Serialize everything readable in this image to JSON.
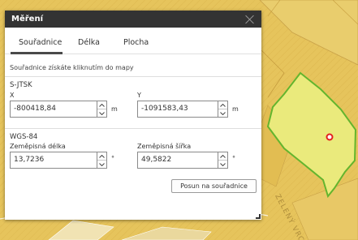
{
  "dialog": {
    "title": "Měření",
    "tabs": [
      {
        "label": "Souřadnice",
        "active": true
      },
      {
        "label": "Délka",
        "active": false
      },
      {
        "label": "Plocha",
        "active": false
      }
    ],
    "hint": "Souřadnice získáte kliknutím do mapy",
    "sjtsk": {
      "section_label": "S-JTSK",
      "x_label": "X",
      "x_value": "-800418,84",
      "x_unit": "m",
      "y_label": "Y",
      "y_value": "-1091583,43",
      "y_unit": "m"
    },
    "wgs84": {
      "section_label": "WGS-84",
      "lon_label": "Zeměpisná délka",
      "lon_value": "13,7236",
      "lon_unit": "°",
      "lat_label": "Zeměpisná šířka",
      "lat_value": "49,5822",
      "lat_unit": "°"
    },
    "shift_button": "Posun na souřadnice"
  },
  "map": {
    "street_label": "ZELENÝ VRCH",
    "colors": {
      "window_frame": "#1f3f95",
      "map_base": "#e5c35a",
      "parcel_fill": "#eaea7c",
      "parcel_outline": "#63b52e",
      "marker": "#e41f1f",
      "titlebar": "#333333"
    }
  }
}
